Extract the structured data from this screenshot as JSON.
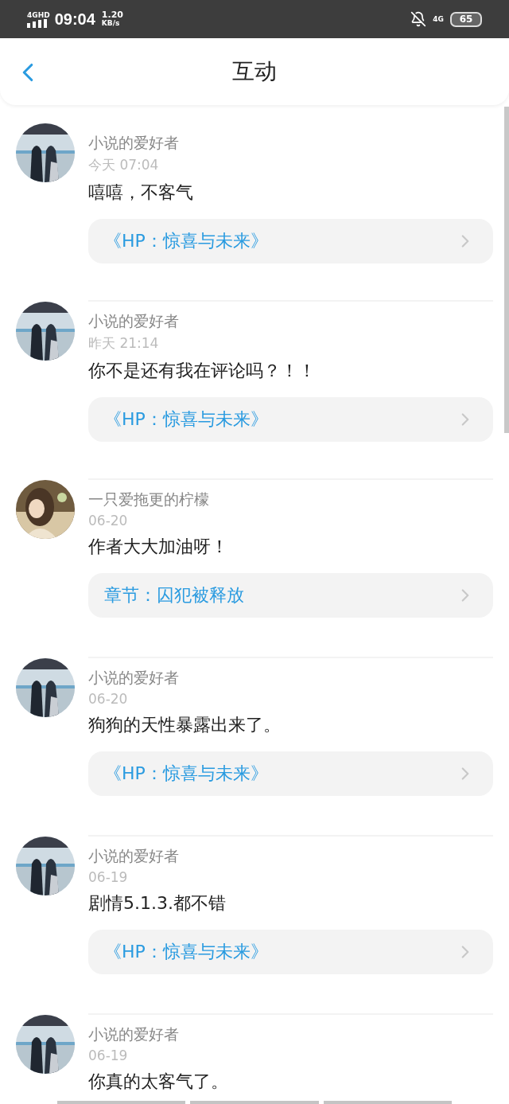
{
  "status_bar": {
    "network": "4GHD",
    "time": "09:04",
    "speed_value": "1.20",
    "speed_unit": "KB/s",
    "mobile_data": "4G",
    "battery": "65"
  },
  "header": {
    "title": "互动"
  },
  "items": [
    {
      "author": "小说的爱好者",
      "time": "今天 07:04",
      "comment": "嘻嘻，不客气",
      "link": "《HP：惊喜与未来》"
    },
    {
      "author": "小说的爱好者",
      "time": "昨天 21:14",
      "comment": "你不是还有我在评论吗？！！",
      "link": "《HP：惊喜与未来》"
    },
    {
      "author": "一只爱拖更的柠檬",
      "time": "06-20",
      "comment": "作者大大加油呀！",
      "link": "章节：囚犯被释放"
    },
    {
      "author": "小说的爱好者",
      "time": "06-20",
      "comment": "狗狗的天性暴露出来了。",
      "link": "《HP：惊喜与未来》"
    },
    {
      "author": "小说的爱好者",
      "time": "06-19",
      "comment": "剧情5.1.3.都不错",
      "link": "《HP：惊喜与未来》"
    },
    {
      "author": "小说的爱好者",
      "time": "06-19",
      "comment": "你真的太客气了。"
    }
  ]
}
